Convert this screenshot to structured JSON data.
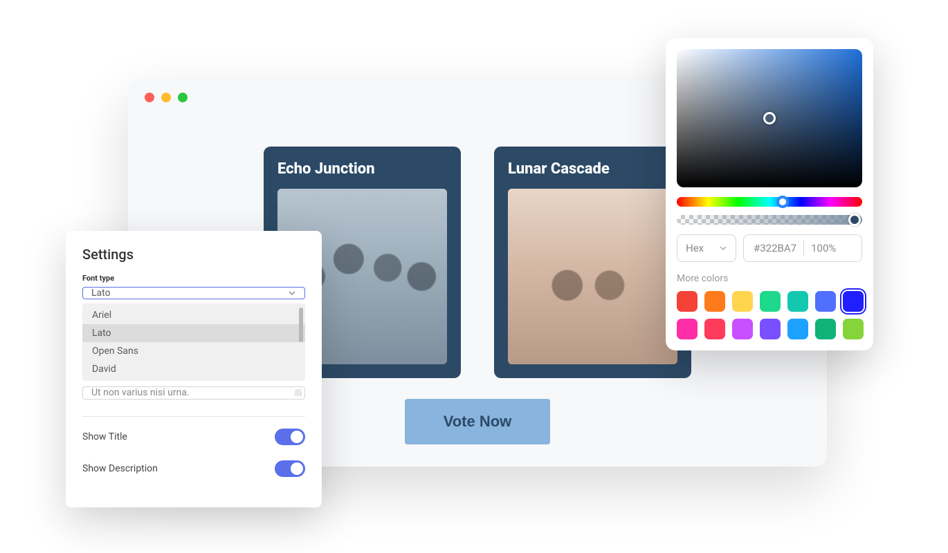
{
  "browser": {
    "cards": [
      {
        "title": "Echo Junction"
      },
      {
        "title": "Lunar Cascade"
      }
    ],
    "vote_label": "Vote Now"
  },
  "settings": {
    "title": "Settings",
    "font_type_label": "Font type",
    "font_selected": "Lato",
    "font_options": [
      "Ariel",
      "Lato",
      "Open Sans",
      "David"
    ],
    "text_value": "Ut non varius nisi urna.",
    "show_title_label": "Show Title",
    "show_title_on": true,
    "show_description_label": "Show Description",
    "show_description_on": true
  },
  "color_picker": {
    "format": "Hex",
    "hex": "#322BA7",
    "opacity": "100%",
    "more_colors_label": "More colors",
    "swatches": [
      "#f44336",
      "#ff7a1a",
      "#ffd54f",
      "#1ed98b",
      "#14c8b0",
      "#4f6fff",
      "#2020ff",
      "#ff2ea6",
      "#ff3b5c",
      "#c84fff",
      "#7a4fff",
      "#1da1ff",
      "#0fb37a",
      "#84d43a"
    ],
    "selected_swatch_index": 6
  }
}
